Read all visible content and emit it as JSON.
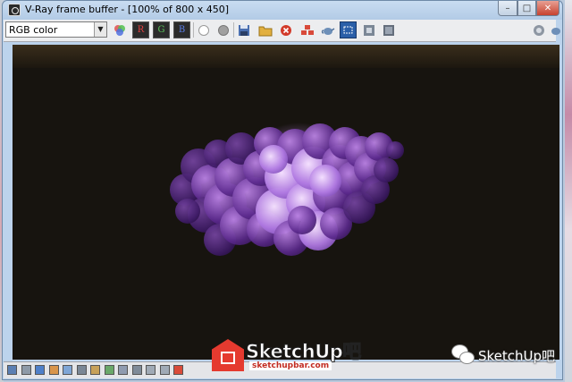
{
  "window": {
    "title": "V-Ray frame buffer - [100% of 800 x 450]",
    "controls": {
      "minimize": "–",
      "maximize": "□",
      "close": "✕"
    }
  },
  "toolbar": {
    "channel_selected": "RGB color",
    "buttons": [
      {
        "name": "color-channels-icon"
      },
      {
        "name": "red-channel-button",
        "label": "R"
      },
      {
        "name": "green-channel-button",
        "label": "G"
      },
      {
        "name": "blue-channel-button",
        "label": "B"
      },
      {
        "name": "alpha-white-icon"
      },
      {
        "name": "mono-gray-icon"
      },
      {
        "name": "save-image-icon"
      },
      {
        "name": "load-image-icon"
      },
      {
        "name": "clear-image-icon"
      },
      {
        "name": "duplicate-vfb-icon"
      },
      {
        "name": "render-teapot-icon"
      },
      {
        "name": "region-render-icon"
      },
      {
        "name": "track-mouse-icon"
      },
      {
        "name": "lens-effects-icon"
      },
      {
        "name": "stereo-icon"
      },
      {
        "name": "settings-icon"
      }
    ],
    "accent": "#2b2b2b"
  },
  "statusbar": {
    "icons": [
      "color-corrections-icon",
      "levels-icon",
      "info-icon",
      "curve-icon",
      "exposure-icon",
      "histogram-icon",
      "lut-icon",
      "background-icon",
      "compare-icon",
      "pixel-aspect-icon",
      "vertical-flip-icon",
      "horizontal-flip-icon",
      "srgb-icon"
    ]
  },
  "watermark": {
    "logo_title": "SketchUp吧",
    "logo_url": "sketchupbar.com",
    "wechat_brand": "SketchUp吧",
    "brand_color": "#e53a2f"
  }
}
